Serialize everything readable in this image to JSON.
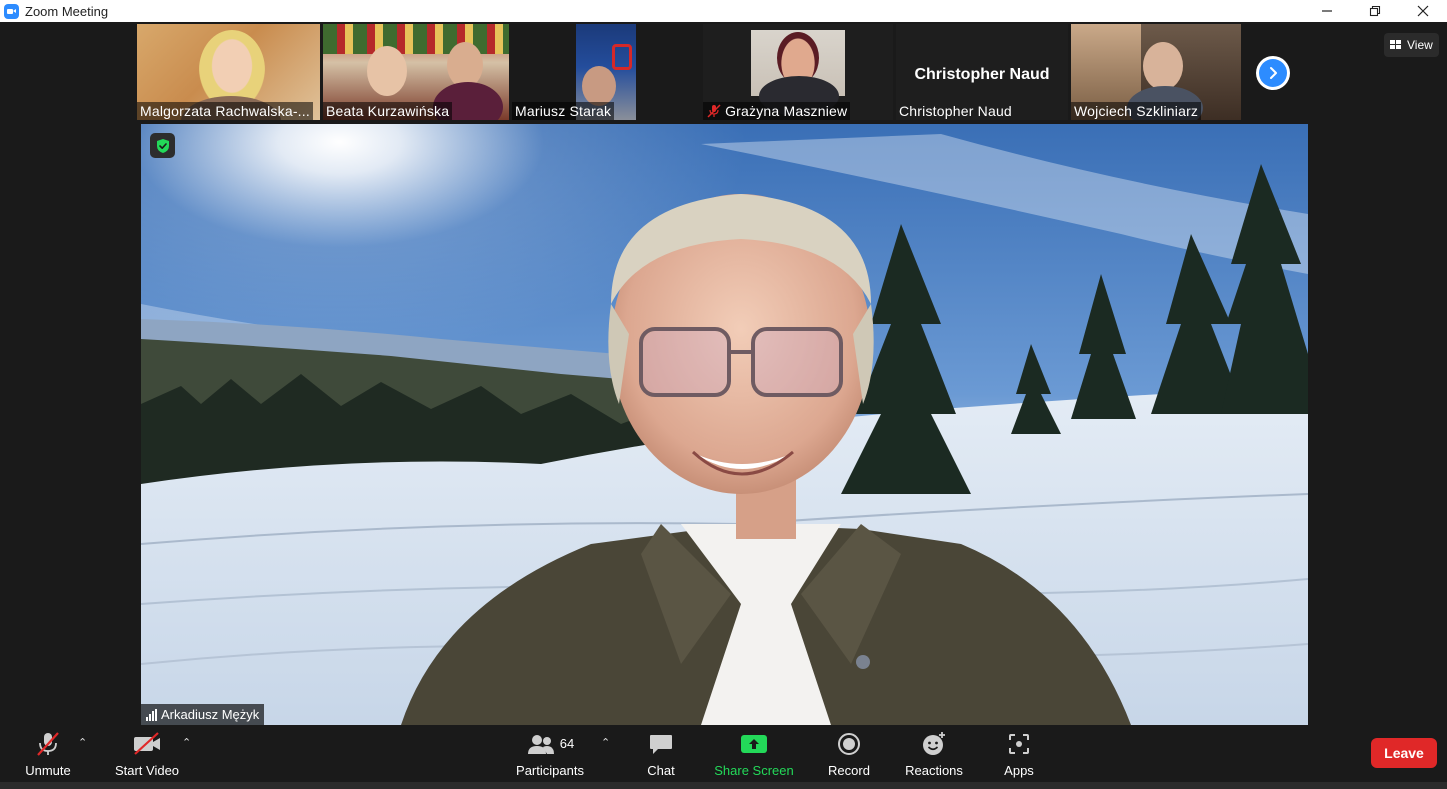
{
  "window": {
    "title": "Zoom Meeting",
    "minimize_icon": "minimize-icon",
    "restore_icon": "restore-icon",
    "close_icon": "close-icon"
  },
  "thumbnails": [
    {
      "name": "Malgorzata Rachwalska-..."
    },
    {
      "name": "Beata Kurzawińska"
    },
    {
      "name": "Mariusz Starak"
    },
    {
      "name": "Grażyna Maszniew",
      "muted": true
    },
    {
      "name": "Christopher Naud",
      "display_name": "Christopher Naud"
    },
    {
      "name": "Wojciech Szkliniarz"
    }
  ],
  "view_button": {
    "label": "View"
  },
  "main_speaker": {
    "name": "Arkadiusz Mężyk"
  },
  "toolbar": {
    "unmute_label": "Unmute",
    "start_video_label": "Start Video",
    "participants_label": "Participants",
    "participants_count": "64",
    "chat_label": "Chat",
    "share_screen_label": "Share Screen",
    "record_label": "Record",
    "reactions_label": "Reactions",
    "apps_label": "Apps",
    "leave_label": "Leave"
  },
  "colors": {
    "accent": "#2d8cff",
    "share_green": "#23d959",
    "leave_red": "#e02828",
    "background": "#1a1a1a"
  }
}
